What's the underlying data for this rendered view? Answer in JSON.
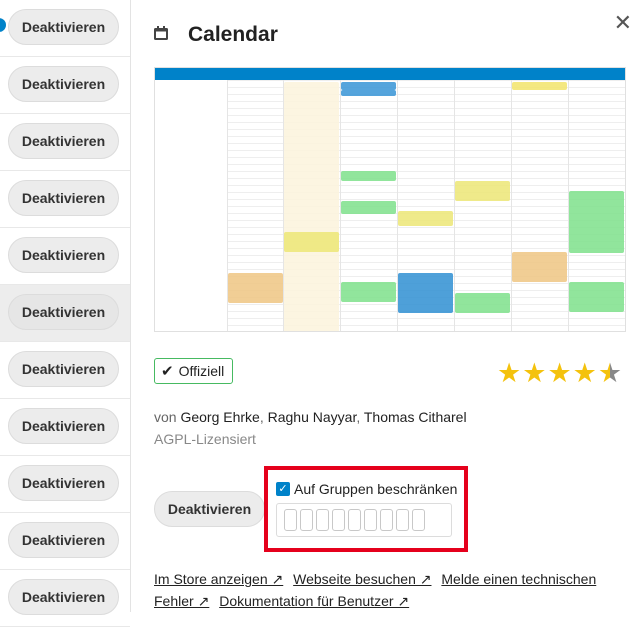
{
  "app_list": {
    "button_label": "Deaktivieren",
    "rows": 11,
    "active_row_index": 5
  },
  "detail": {
    "title": "Calendar",
    "close": "✕",
    "badge": "Offiziell",
    "rating": 4.5,
    "authors_prefix": "von",
    "authors": [
      "Georg Ehrke",
      "Raghu Nayyar",
      "Thomas Citharel"
    ],
    "license": "AGPL-Lizensiert",
    "deactivate_label": "Deaktivieren",
    "restrict_label": "Auf Gruppen beschränken",
    "restrict_checked": true,
    "links": [
      "Im Store anzeigen ↗",
      "Webseite besuchen ↗",
      "Melde einen technischen Fehler ↗",
      "Dokumentation für Benutzer ↗"
    ]
  },
  "colors": {
    "accent": "#0082c9",
    "badge_border": "#46ba61",
    "highlight": "#e5001c",
    "star": "#f4c20d"
  }
}
